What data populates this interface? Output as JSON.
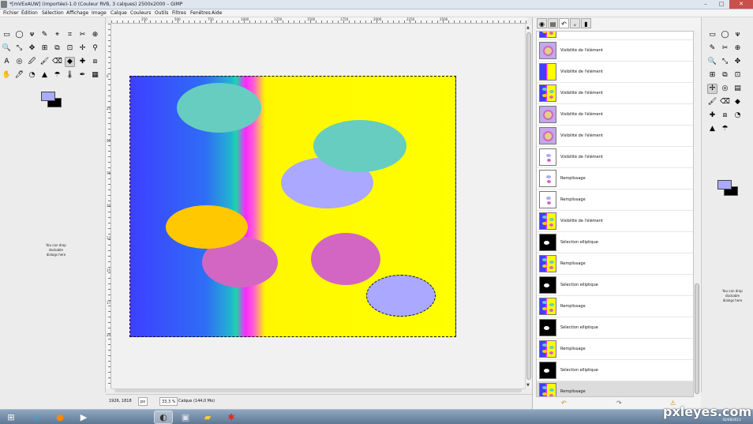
{
  "window": {
    "title": "*[mVExAUW] (importée)-1.0 (Couleur RVB, 3 calques) 2500x2000 – GIMP",
    "minimize": "–",
    "maximize": "□",
    "close": "✕"
  },
  "menu": [
    "Fichier",
    "Édition",
    "Sélection",
    "Affichage",
    "Image",
    "Calque",
    "Couleurs",
    "Outils",
    "Filtres",
    "Fenêtres",
    "Aide"
  ],
  "toolbox": {
    "left_tools": [
      "▭",
      "◯",
      "ᴪ",
      "✎",
      "⌖",
      "⌗",
      "✂",
      "⊕",
      "🔍",
      "⤡",
      "✥",
      "⊞",
      "⧉",
      "⊡",
      "✢",
      "⚲",
      "A",
      "◎",
      "🖉",
      "🖌",
      "⌫",
      "◆",
      "✚",
      "⧈",
      "✋",
      "🖊",
      "◔",
      "▲",
      "☂",
      "🌡",
      "✒",
      "▦"
    ],
    "right_tools": [
      "▭",
      "◯",
      "ᴪ",
      "✎",
      "✂",
      "⊕",
      "🔍",
      "⤡",
      "✥",
      "⊞",
      "⧉",
      "⊡",
      "✢",
      "◎",
      "▤",
      "🖌",
      "⌫",
      "◆",
      "✚",
      "⧈",
      "◔",
      "▲",
      "☂"
    ],
    "fg_color": "#aaaaff",
    "bg_color": "#000000",
    "drop_hint": "You can drop dockable dialogs here"
  },
  "rulers": {
    "h_labels": [
      "250",
      "500",
      "750",
      "1000",
      "1250",
      "1500",
      "1750",
      "2000",
      "2250",
      "2500"
    ],
    "v_labels": [
      "0",
      "250",
      "500",
      "750",
      "1000",
      "1250",
      "1500",
      "1750",
      "2000"
    ]
  },
  "status": {
    "coords": "1926, 1818",
    "unit": "px",
    "zoom": "33,3 %",
    "layer_info": "Calque (144,0 Mo)"
  },
  "undo_history": {
    "tabs": [
      "layers-tab",
      "channels-tab",
      "paths-tab",
      "undo-tab",
      "brush-tab"
    ],
    "items": [
      {
        "label": "",
        "thumb": "full",
        "partial": true
      },
      {
        "label": "Visibilité de l'élément",
        "thumb": "purple-mixed"
      },
      {
        "label": "Visibilité de l'élément",
        "thumb": "blue-yellow"
      },
      {
        "label": "Visibilité de l'élément",
        "thumb": "full"
      },
      {
        "label": "Visibilité de l'élément",
        "thumb": "purple-mixed"
      },
      {
        "label": "Visibilité de l'élément",
        "thumb": "purple-mixed"
      },
      {
        "label": "Visibilité de l'élément",
        "thumb": "white-dots"
      },
      {
        "label": "Remplissage",
        "thumb": "white-dots"
      },
      {
        "label": "Remplissage",
        "thumb": "white-dots"
      },
      {
        "label": "Visibilité de l'élément",
        "thumb": "full"
      },
      {
        "label": "Sélection elliptique",
        "thumb": "black"
      },
      {
        "label": "Remplissage",
        "thumb": "full"
      },
      {
        "label": "Sélection elliptique",
        "thumb": "black"
      },
      {
        "label": "Remplissage",
        "thumb": "full"
      },
      {
        "label": "Sélection elliptique",
        "thumb": "black"
      },
      {
        "label": "Remplissage",
        "thumb": "full"
      },
      {
        "label": "Sélection elliptique",
        "thumb": "black"
      },
      {
        "label": "Remplissage",
        "thumb": "full",
        "selected": true
      }
    ],
    "buttons": [
      "undo-icon",
      "redo-icon",
      "clear-history-icon"
    ]
  },
  "taskbar": {
    "apps": [
      "start-button",
      "ie-icon",
      "firefox-icon",
      "media-player-icon",
      "gimp-icon",
      "photo-icon",
      "explorer-icon",
      "paint-icon"
    ],
    "time": "",
    "date": "02/08/2013"
  },
  "watermark": "pxleyes.com"
}
